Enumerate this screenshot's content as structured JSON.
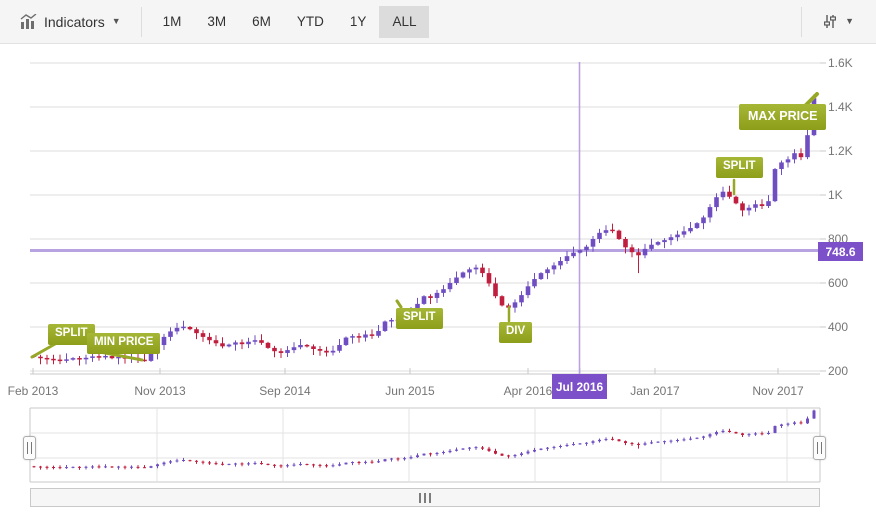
{
  "toolbar": {
    "indicators_label": "Indicators",
    "periods": [
      "1M",
      "3M",
      "6M",
      "YTD",
      "1Y",
      "ALL"
    ],
    "active_period": "ALL",
    "icons": {
      "indicators_icon": "bar-chart-with-trend",
      "settings_icon": "vertical-sliders",
      "caret": "▼"
    }
  },
  "chart": {
    "yaxis_labels": [
      "1.6K",
      "1.4K",
      "1.2K",
      "1K",
      "800",
      "600",
      "400",
      "200"
    ],
    "xaxis_labels": [
      "Feb 2013",
      "Nov 2013",
      "Sep 2014",
      "Jun 2015",
      "Apr 2016",
      "Jan 2017",
      "Nov 2017"
    ],
    "crosshair": {
      "date_label": "Jul 2016",
      "value_label": "748.6"
    },
    "annotations": [
      {
        "label": "SPLIT"
      },
      {
        "label": "MIN PRICE"
      },
      {
        "label": "SPLIT"
      },
      {
        "label": "DIV"
      },
      {
        "label": "SPLIT"
      },
      {
        "label": "MAX PRICE"
      }
    ],
    "colors": {
      "up_candle": "#6f4ec2",
      "down_candle": "#c01e3e",
      "crosshair": "#b7a3e0",
      "crosshair_badge": "#7c50c8",
      "annotation_green": "#97a827",
      "gridline": "#dcdcdc",
      "axis_line": "#c8c8c8",
      "axis_text": "#757575",
      "toolbar_bg": "#f5f5f5",
      "active_period_bg": "#dcdcdc"
    }
  },
  "chart_data": {
    "type": "candlestick",
    "title": "",
    "x_axis": {
      "labels": [
        "Feb 2013",
        "Nov 2013",
        "Sep 2014",
        "Jun 2015",
        "Apr 2016",
        "Jul 2016",
        "Jan 2017",
        "Nov 2017"
      ],
      "range": [
        "Feb 2013",
        "Dec 2017"
      ]
    },
    "y_axis": {
      "min": 200,
      "max": 1600,
      "tick_step": 200,
      "labels": [
        "200",
        "400",
        "600",
        "800",
        "1K",
        "1.2K",
        "1.4K",
        "1.6K"
      ],
      "position": "right",
      "grid": true
    },
    "first_open": 270,
    "series": [
      {
        "name": "price",
        "type": "candlestick",
        "closes": [
          265,
          258,
          254,
          250,
          247,
          252,
          258,
          253,
          260,
          266,
          262,
          268,
          258,
          264,
          256,
          260,
          250,
          246,
          280,
          318,
          355,
          380,
          396,
          400,
          390,
          372,
          355,
          340,
          326,
          312,
          320,
          330,
          322,
          333,
          340,
          328,
          305,
          290,
          282,
          295,
          308,
          318,
          312,
          300,
          292,
          284,
          292,
          318,
          352,
          358,
          352,
          366,
          360,
          382,
          425,
          432,
          428,
          442,
          468,
          505,
          540,
          532,
          555,
          572,
          600,
          625,
          648,
          662,
          670,
          645,
          598,
          540,
          498,
          488,
          512,
          545,
          585,
          618,
          645,
          662,
          680,
          700,
          722,
          738,
          749,
          765,
          800,
          828,
          840,
          838,
          800,
          762,
          740,
          726,
          755,
          774,
          786,
          795,
          808,
          820,
          835,
          850,
          872,
          898,
          945,
          990,
          1015,
          992,
          962,
          930,
          942,
          958,
          950,
          972,
          1118,
          1148,
          1162,
          1190,
          1172,
          1272,
          1440
        ]
      }
    ],
    "wick_low_overrides": {
      "17": 242,
      "93": 645
    },
    "wick_high_overrides": {
      "120": 1458
    },
    "min_price": 242,
    "max_price": 1458,
    "crosshair": {
      "x_label": "Jul 2016",
      "y_value": 748.6,
      "candle_index": 84
    },
    "annotations": [
      {
        "label": "SPLIT",
        "candle_index": 1
      },
      {
        "label": "MIN PRICE",
        "candle_index": 17
      },
      {
        "label": "SPLIT",
        "candle_index": 56
      },
      {
        "label": "DIV",
        "candle_index": 73
      },
      {
        "label": "SPLIT",
        "candle_index": 107
      },
      {
        "label": "MAX PRICE",
        "candle_index": 120
      }
    ],
    "navigator": {
      "type": "candlestick",
      "shows_full_series": true,
      "grid": true
    }
  }
}
